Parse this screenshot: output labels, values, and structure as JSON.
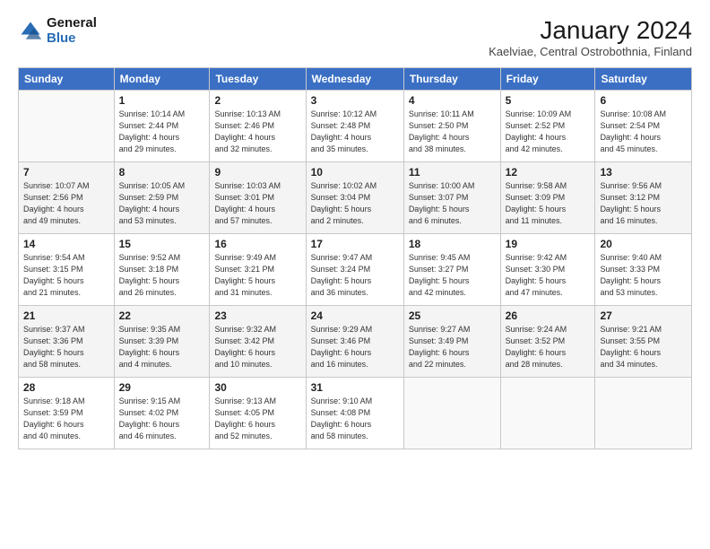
{
  "logo": {
    "general": "General",
    "blue": "Blue"
  },
  "title": "January 2024",
  "subtitle": "Kaelviae, Central Ostrobothnia, Finland",
  "days_of_week": [
    "Sunday",
    "Monday",
    "Tuesday",
    "Wednesday",
    "Thursday",
    "Friday",
    "Saturday"
  ],
  "weeks": [
    [
      {
        "day": "",
        "info": ""
      },
      {
        "day": "1",
        "info": "Sunrise: 10:14 AM\nSunset: 2:44 PM\nDaylight: 4 hours\nand 29 minutes."
      },
      {
        "day": "2",
        "info": "Sunrise: 10:13 AM\nSunset: 2:46 PM\nDaylight: 4 hours\nand 32 minutes."
      },
      {
        "day": "3",
        "info": "Sunrise: 10:12 AM\nSunset: 2:48 PM\nDaylight: 4 hours\nand 35 minutes."
      },
      {
        "day": "4",
        "info": "Sunrise: 10:11 AM\nSunset: 2:50 PM\nDaylight: 4 hours\nand 38 minutes."
      },
      {
        "day": "5",
        "info": "Sunrise: 10:09 AM\nSunset: 2:52 PM\nDaylight: 4 hours\nand 42 minutes."
      },
      {
        "day": "6",
        "info": "Sunrise: 10:08 AM\nSunset: 2:54 PM\nDaylight: 4 hours\nand 45 minutes."
      }
    ],
    [
      {
        "day": "7",
        "info": "Sunrise: 10:07 AM\nSunset: 2:56 PM\nDaylight: 4 hours\nand 49 minutes."
      },
      {
        "day": "8",
        "info": "Sunrise: 10:05 AM\nSunset: 2:59 PM\nDaylight: 4 hours\nand 53 minutes."
      },
      {
        "day": "9",
        "info": "Sunrise: 10:03 AM\nSunset: 3:01 PM\nDaylight: 4 hours\nand 57 minutes."
      },
      {
        "day": "10",
        "info": "Sunrise: 10:02 AM\nSunset: 3:04 PM\nDaylight: 5 hours\nand 2 minutes."
      },
      {
        "day": "11",
        "info": "Sunrise: 10:00 AM\nSunset: 3:07 PM\nDaylight: 5 hours\nand 6 minutes."
      },
      {
        "day": "12",
        "info": "Sunrise: 9:58 AM\nSunset: 3:09 PM\nDaylight: 5 hours\nand 11 minutes."
      },
      {
        "day": "13",
        "info": "Sunrise: 9:56 AM\nSunset: 3:12 PM\nDaylight: 5 hours\nand 16 minutes."
      }
    ],
    [
      {
        "day": "14",
        "info": "Sunrise: 9:54 AM\nSunset: 3:15 PM\nDaylight: 5 hours\nand 21 minutes."
      },
      {
        "day": "15",
        "info": "Sunrise: 9:52 AM\nSunset: 3:18 PM\nDaylight: 5 hours\nand 26 minutes."
      },
      {
        "day": "16",
        "info": "Sunrise: 9:49 AM\nSunset: 3:21 PM\nDaylight: 5 hours\nand 31 minutes."
      },
      {
        "day": "17",
        "info": "Sunrise: 9:47 AM\nSunset: 3:24 PM\nDaylight: 5 hours\nand 36 minutes."
      },
      {
        "day": "18",
        "info": "Sunrise: 9:45 AM\nSunset: 3:27 PM\nDaylight: 5 hours\nand 42 minutes."
      },
      {
        "day": "19",
        "info": "Sunrise: 9:42 AM\nSunset: 3:30 PM\nDaylight: 5 hours\nand 47 minutes."
      },
      {
        "day": "20",
        "info": "Sunrise: 9:40 AM\nSunset: 3:33 PM\nDaylight: 5 hours\nand 53 minutes."
      }
    ],
    [
      {
        "day": "21",
        "info": "Sunrise: 9:37 AM\nSunset: 3:36 PM\nDaylight: 5 hours\nand 58 minutes."
      },
      {
        "day": "22",
        "info": "Sunrise: 9:35 AM\nSunset: 3:39 PM\nDaylight: 6 hours\nand 4 minutes."
      },
      {
        "day": "23",
        "info": "Sunrise: 9:32 AM\nSunset: 3:42 PM\nDaylight: 6 hours\nand 10 minutes."
      },
      {
        "day": "24",
        "info": "Sunrise: 9:29 AM\nSunset: 3:46 PM\nDaylight: 6 hours\nand 16 minutes."
      },
      {
        "day": "25",
        "info": "Sunrise: 9:27 AM\nSunset: 3:49 PM\nDaylight: 6 hours\nand 22 minutes."
      },
      {
        "day": "26",
        "info": "Sunrise: 9:24 AM\nSunset: 3:52 PM\nDaylight: 6 hours\nand 28 minutes."
      },
      {
        "day": "27",
        "info": "Sunrise: 9:21 AM\nSunset: 3:55 PM\nDaylight: 6 hours\nand 34 minutes."
      }
    ],
    [
      {
        "day": "28",
        "info": "Sunrise: 9:18 AM\nSunset: 3:59 PM\nDaylight: 6 hours\nand 40 minutes."
      },
      {
        "day": "29",
        "info": "Sunrise: 9:15 AM\nSunset: 4:02 PM\nDaylight: 6 hours\nand 46 minutes."
      },
      {
        "day": "30",
        "info": "Sunrise: 9:13 AM\nSunset: 4:05 PM\nDaylight: 6 hours\nand 52 minutes."
      },
      {
        "day": "31",
        "info": "Sunrise: 9:10 AM\nSunset: 4:08 PM\nDaylight: 6 hours\nand 58 minutes."
      },
      {
        "day": "",
        "info": ""
      },
      {
        "day": "",
        "info": ""
      },
      {
        "day": "",
        "info": ""
      }
    ]
  ]
}
